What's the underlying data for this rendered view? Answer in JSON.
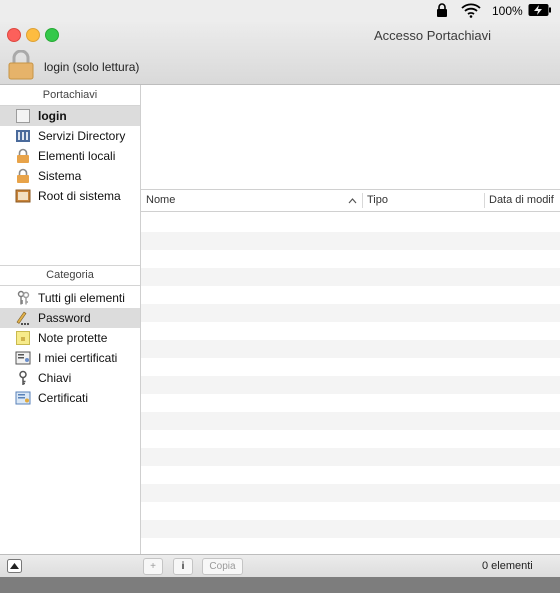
{
  "menubar": {
    "battery_text": "100%"
  },
  "window": {
    "title": "Accesso Portachiavi",
    "lock_label": "login (solo lettura)"
  },
  "sidebar": {
    "keychains_header": "Portachiavi",
    "keychains": [
      {
        "label": "login",
        "icon": "keychain-blank-icon",
        "selected": true
      },
      {
        "label": "Servizi Directory",
        "icon": "directory-icon",
        "selected": false
      },
      {
        "label": "Elementi locali",
        "icon": "lock-icon",
        "selected": false
      },
      {
        "label": "Sistema",
        "icon": "lock-icon",
        "selected": false
      },
      {
        "label": "Root di sistema",
        "icon": "cabinet-icon",
        "selected": false
      }
    ],
    "category_header": "Categoria",
    "categories": [
      {
        "label": "Tutti gli elementi",
        "icon": "keys-icon",
        "selected": false
      },
      {
        "label": "Password",
        "icon": "pencil-dots-icon",
        "selected": true
      },
      {
        "label": "Note protette",
        "icon": "note-icon",
        "selected": false
      },
      {
        "label": "I miei certificati",
        "icon": "my-certificate-icon",
        "selected": false
      },
      {
        "label": "Chiavi",
        "icon": "key-icon",
        "selected": false
      },
      {
        "label": "Certificati",
        "icon": "certificate-icon",
        "selected": false
      }
    ]
  },
  "table": {
    "columns": [
      "Nome",
      "Tipo",
      "Data di modif"
    ]
  },
  "footer": {
    "add": "+",
    "info": "i",
    "copy": "Copia",
    "count": "0 elementi"
  },
  "colors": {
    "selected_bg": "#dcdcdc",
    "stripe": "#f4f4f4"
  }
}
